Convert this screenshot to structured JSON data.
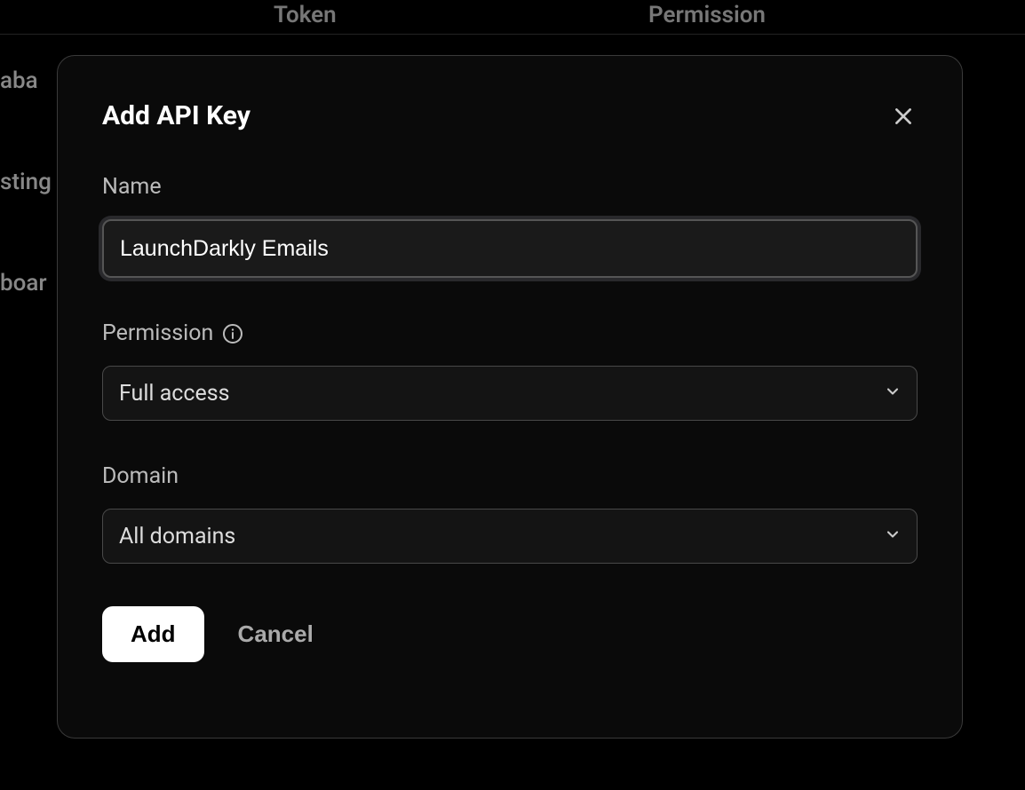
{
  "background": {
    "header_token": "Token",
    "header_permission": "Permission",
    "snippets": [
      "aba",
      "sting",
      "boar"
    ]
  },
  "modal": {
    "title": "Add API Key",
    "form": {
      "name_label": "Name",
      "name_value": "LaunchDarkly Emails",
      "permission_label": "Permission",
      "permission_value": "Full access",
      "domain_label": "Domain",
      "domain_value": "All domains"
    },
    "buttons": {
      "add": "Add",
      "cancel": "Cancel"
    }
  }
}
